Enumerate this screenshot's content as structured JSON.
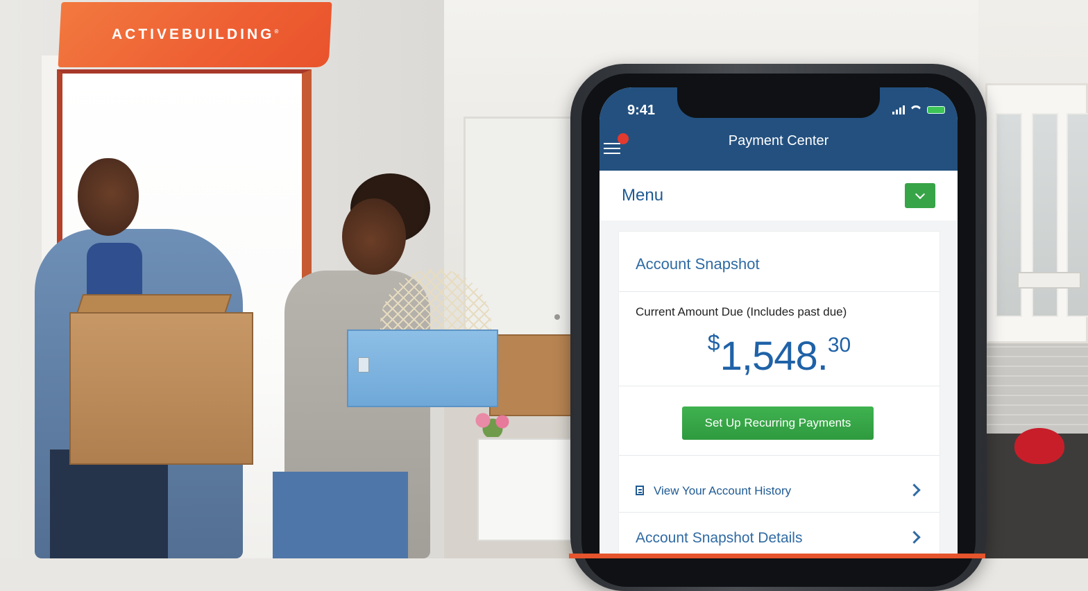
{
  "brand": {
    "name": "ACTIVEBUILDING",
    "mark": "®"
  },
  "status_bar": {
    "time": "9:41"
  },
  "header": {
    "title": "Payment Center"
  },
  "menu": {
    "label": "Menu"
  },
  "snapshot": {
    "title": "Account Snapshot",
    "amount_label": "Current Amount Due (Includes past due)",
    "amount_currency": "$",
    "amount_main": "1,548.",
    "amount_cents": "30",
    "cta_label": "Set Up Recurring Payments"
  },
  "links": {
    "history_label": "View Your Account History",
    "details_label": "Account Snapshot Details"
  },
  "icons": {
    "menu": "hamburger-icon",
    "notification": "notification-dot-icon",
    "dropdown": "chevron-down-icon",
    "history": "document-icon",
    "row_arrow": "chevron-right-icon"
  },
  "colors": {
    "brand_orange": "#ee5f33",
    "header_blue": "#23507f",
    "link_blue": "#1f5a93",
    "accent_green": "#37a448"
  }
}
